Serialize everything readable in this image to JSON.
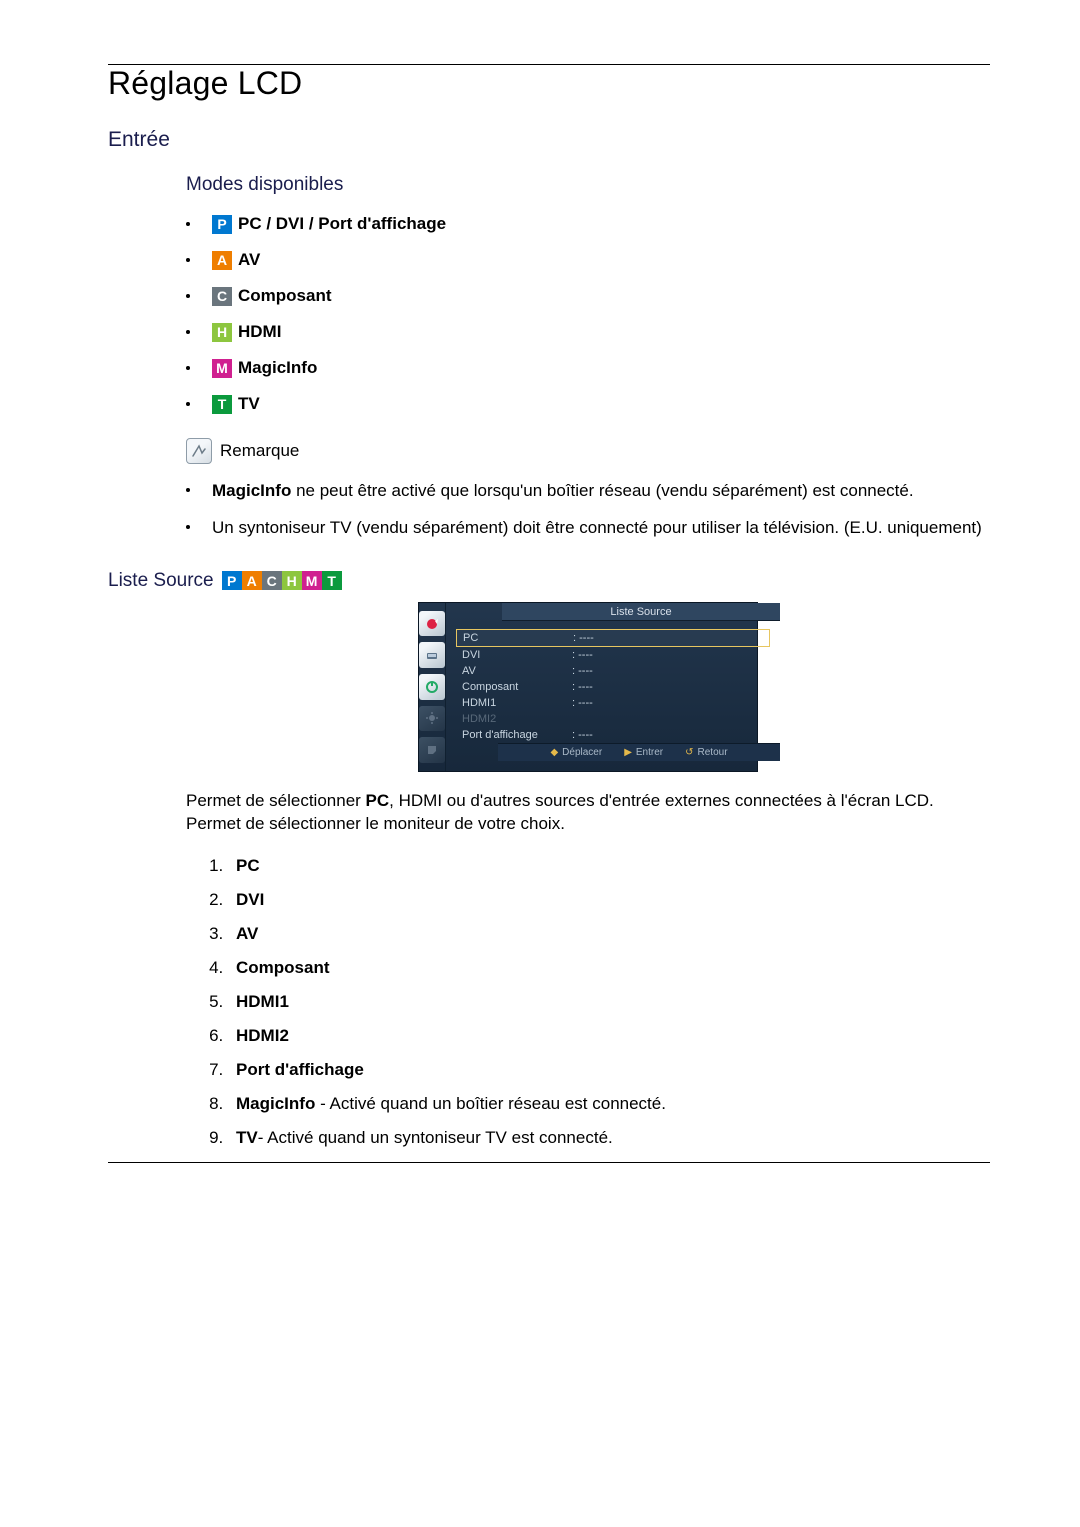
{
  "title": "Réglage LCD",
  "section_input": "Entrée",
  "modes_heading": "Modes disponibles",
  "modes": [
    {
      "letter": "P",
      "class": "badge-P",
      "label": "PC / DVI / Port d'affichage"
    },
    {
      "letter": "A",
      "class": "badge-A",
      "label": "AV"
    },
    {
      "letter": "C",
      "class": "badge-C",
      "label": "Composant"
    },
    {
      "letter": "H",
      "class": "badge-H",
      "label": "HDMI"
    },
    {
      "letter": "M",
      "class": "badge-M",
      "label": "MagicInfo"
    },
    {
      "letter": "T",
      "class": "badge-T",
      "label": "TV"
    }
  ],
  "note_label": "Remarque",
  "notes": {
    "n1_strong": "MagicInfo",
    "n1_rest": " ne peut être activé que lorsqu'un boîtier réseau (vendu séparément) est connecté.",
    "n2": "Un syntoniseur TV (vendu séparément) doit être connecté pour utiliser la télévision. (E.U. uniquement)"
  },
  "liste_source": "Liste Source",
  "badge_strip": [
    "P",
    "A",
    "C",
    "H",
    "M",
    "T"
  ],
  "osd": {
    "title": "Liste Source",
    "rows": [
      {
        "label": "PC",
        "val": "----",
        "sel": true
      },
      {
        "label": "DVI",
        "val": "----"
      },
      {
        "label": "AV",
        "val": "----"
      },
      {
        "label": "Composant",
        "val": "----"
      },
      {
        "label": "HDMI1",
        "val": "----"
      },
      {
        "label": "HDMI2",
        "val": "",
        "disabled": true
      },
      {
        "label": "Port d'affichage",
        "val": "----"
      }
    ],
    "foot": {
      "move": "Déplacer",
      "enter": "Entrer",
      "ret": "Retour"
    }
  },
  "desc_pre": "Permet de sélectionner ",
  "desc_b1": "PC",
  "desc_mid": ", HDMI ou d'autres sources d'entrée externes connectées à l'écran LCD. Permet de sélectionner le moniteur de votre choix.",
  "src_items": {
    "i1": "PC",
    "i2": "DVI",
    "i3": "AV",
    "i4": "Composant",
    "i5": "HDMI1",
    "i6": "HDMI2",
    "i7": "Port d'affichage",
    "i8_b": "MagicInfo",
    "i8_rest": " - Activé quand un boîtier réseau est connecté.",
    "i9_b": "TV",
    "i9_rest": "- Activé quand un syntoniseur TV est connecté."
  }
}
